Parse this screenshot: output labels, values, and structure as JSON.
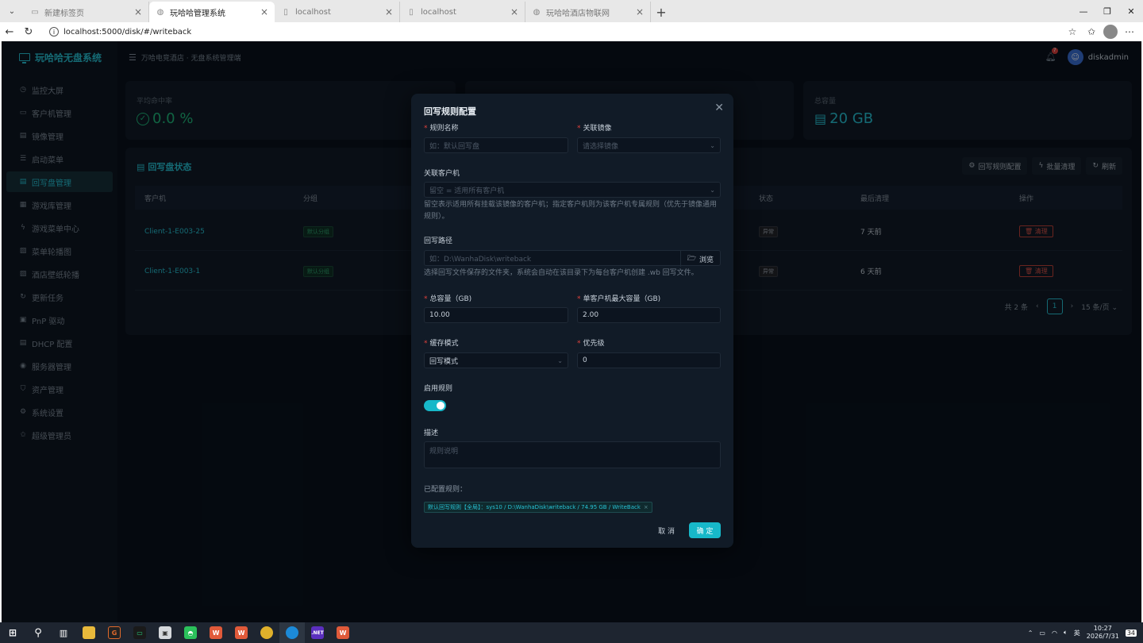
{
  "browser": {
    "tabs": [
      {
        "title": "新建标签页",
        "active": false
      },
      {
        "title": "玩哈哈管理系统",
        "active": true
      },
      {
        "title": "localhost",
        "active": false
      },
      {
        "title": "localhost",
        "active": false
      },
      {
        "title": "玩哈哈酒店物联网",
        "active": false
      }
    ],
    "url": "localhost:5000/disk/#/writeback"
  },
  "app": {
    "logo_text": "玩哈哈无盘系统",
    "breadcrumb": "万哈电竞酒店 · 无盘系统管理端",
    "notification_count": "7",
    "username": "diskadmin",
    "menu": [
      {
        "label": "监控大屏",
        "icon": "dashboard-icon",
        "active": false
      },
      {
        "label": "客户机管理",
        "icon": "monitor-icon",
        "active": false
      },
      {
        "label": "镜像管理",
        "icon": "image-icon",
        "active": false
      },
      {
        "label": "启动菜单",
        "icon": "list-icon",
        "active": false
      },
      {
        "label": "回写盘管理",
        "icon": "disk-icon",
        "active": true
      },
      {
        "label": "游戏库管理",
        "icon": "grid-icon",
        "active": false
      },
      {
        "label": "游戏菜单中心",
        "icon": "bolt-icon",
        "active": false
      },
      {
        "label": "菜单轮播图",
        "icon": "picture-icon",
        "active": false
      },
      {
        "label": "酒店壁纸轮播",
        "icon": "picture-icon",
        "active": false
      },
      {
        "label": "更新任务",
        "icon": "refresh-icon",
        "active": false
      },
      {
        "label": "PnP 驱动",
        "icon": "chip-icon",
        "active": false
      },
      {
        "label": "DHCP 配置",
        "icon": "network-icon",
        "active": false
      },
      {
        "label": "服务器管理",
        "icon": "server-icon",
        "active": false
      },
      {
        "label": "资产管理",
        "icon": "shield-icon",
        "active": false
      },
      {
        "label": "系统设置",
        "icon": "gear-icon",
        "active": false
      },
      {
        "label": "超级管理员",
        "icon": "star-icon",
        "active": false
      }
    ],
    "stats": [
      {
        "label": "平均命中率",
        "value": "0.0 %",
        "color": "#1fb67a"
      },
      {
        "label": "总容量",
        "value": "20 GB",
        "color": "#27c2d4"
      }
    ],
    "panel": {
      "title": "回写盘状态",
      "actions": [
        "回写规则配置",
        "批量清理",
        "刷新"
      ],
      "columns": [
        "客户机",
        "分组",
        "状态",
        "最后清理",
        "操作"
      ],
      "rows": [
        {
          "client": "Client-1-E003-25",
          "group": "默认分组",
          "status": "异常",
          "last_clean": "7 天前",
          "action": "清理"
        },
        {
          "client": "Client-1-E003-1",
          "group": "默认分组",
          "status": "异常",
          "last_clean": "6 天前",
          "action": "清理"
        }
      ],
      "pager": {
        "total": "共 2 条",
        "page": "1",
        "page_size": "15 条/页"
      }
    }
  },
  "modal": {
    "title": "回写规则配置",
    "rule_name": {
      "label": "规则名称",
      "placeholder": "如：默认回写盘"
    },
    "image": {
      "label": "关联镜像",
      "placeholder": "请选择镜像"
    },
    "clients": {
      "label": "关联客户机",
      "placeholder": "留空 = 适用所有客户机",
      "hint": "留空表示适用所有挂载该镜像的客户机；指定客户机则为该客户机专属规则（优先于镜像通用规则）。"
    },
    "path": {
      "label": "回写路径",
      "placeholder": "如：D:\\WanhaDisk\\writeback",
      "browse": "浏览",
      "hint": "选择回写文件保存的文件夹，系统会自动在该目录下为每台客户机创建 .wb 回写文件。"
    },
    "total_capacity": {
      "label": "总容量（GB)",
      "value": "10.00"
    },
    "max_per_client": {
      "label": "单客户机最大容量（GB)",
      "value": "2.00"
    },
    "cache_mode": {
      "label": "缓存模式",
      "value": "回写模式"
    },
    "priority": {
      "label": "优先级",
      "value": "0"
    },
    "enabled": {
      "label": "启用规则",
      "value": true
    },
    "description": {
      "label": "描述",
      "placeholder": "规则说明"
    },
    "configured": {
      "label": "已配置规则：",
      "rules": [
        "默认回写规则【全局】：sys10 / D:\\WanhaDisk\\writeback / 74.95 GB / WriteBack"
      ]
    },
    "cancel": "取 消",
    "ok": "确 定"
  },
  "taskbar": {
    "time": "10:27",
    "date": "2026/7/31",
    "ime": "英",
    "notifications": "34"
  }
}
